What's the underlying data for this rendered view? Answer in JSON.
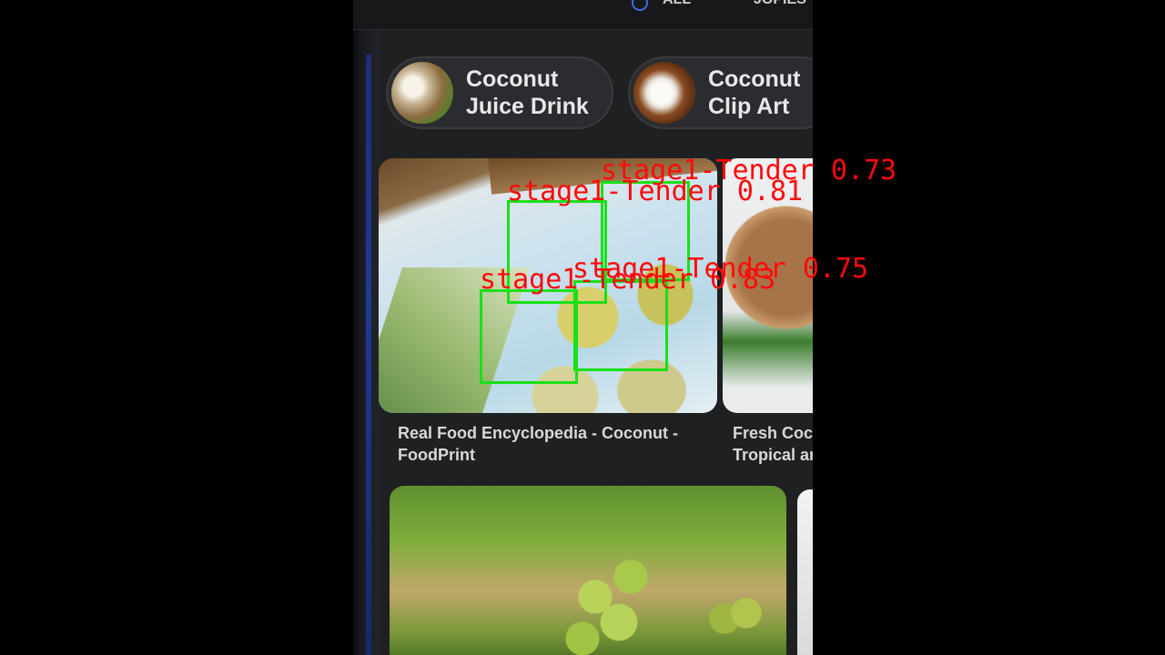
{
  "top_bar": {
    "text_1": "ALL",
    "text_2": "JOPIES"
  },
  "chips": [
    {
      "line1": "Coconut",
      "line2": "Juice Drink"
    },
    {
      "line1": "Coconut",
      "line2": "Clip Art"
    }
  ],
  "results": [
    {
      "title_line1": "Real Food Encyclopedia - Coconut -",
      "title_line2": "FoodPrint"
    },
    {
      "title_line1": "Fresh Coc",
      "title_line2": "Tropical ar"
    }
  ],
  "detections": [
    {
      "label": "stage1-Tender 0.73",
      "box_color": "#19e019",
      "text_color": "#ff0a0a"
    },
    {
      "label": "stage1-Tender 0.81",
      "box_color": "#19e019",
      "text_color": "#ff0a0a"
    },
    {
      "label": "stage1-Tender 0.75",
      "box_color": "#19e019",
      "text_color": "#ff0a0a"
    },
    {
      "label": "stage1-Tender 0.83",
      "box_color": "#19e019",
      "text_color": "#ff0a0a"
    }
  ]
}
